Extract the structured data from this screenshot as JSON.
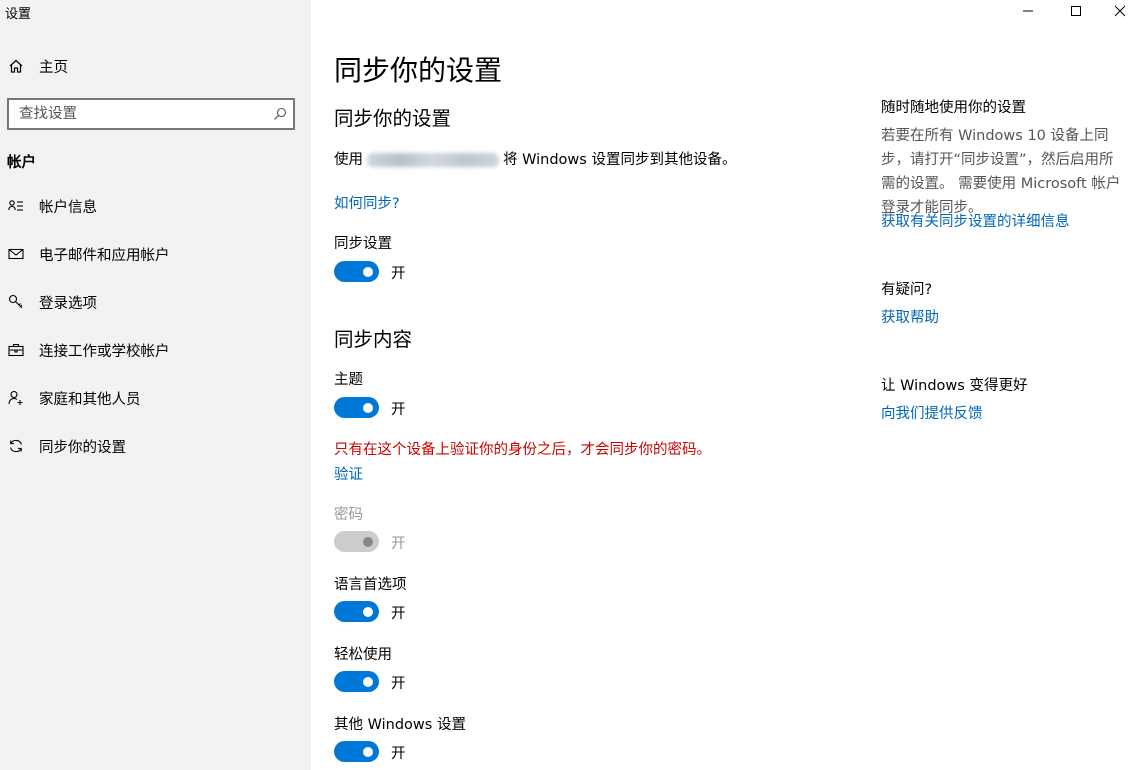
{
  "window": {
    "title": "设置",
    "controls": {
      "minimize_icon": "minimize-icon",
      "maximize_icon": "maximize-icon",
      "close_icon": "close-icon"
    }
  },
  "sidebar": {
    "home_label": "主页",
    "search": {
      "placeholder": "查找设置",
      "value": ""
    },
    "section_title": "帐户",
    "items": [
      {
        "label": "帐户信息",
        "icon": "account-info-icon"
      },
      {
        "label": "电子邮件和应用帐户",
        "icon": "mail-icon"
      },
      {
        "label": "登录选项",
        "icon": "key-icon"
      },
      {
        "label": "连接工作或学校帐户",
        "icon": "briefcase-icon"
      },
      {
        "label": "家庭和其他人员",
        "icon": "add-person-icon"
      },
      {
        "label": "同步你的设置",
        "icon": "sync-icon"
      }
    ]
  },
  "main": {
    "page_title": "同步你的设置",
    "sync_heading": "同步你的设置",
    "sync_desc_prefix": "使用",
    "sync_desc_suffix": "将 Windows 设置同步到其他设备。",
    "how_link": "如何同步?",
    "sync_setting_label": "同步设置",
    "sync_setting_state": "开",
    "content_heading": "同步内容",
    "theme_label": "主题",
    "theme_state": "开",
    "warning": "只有在这个设备上验证你的身份之后，才会同步你的密码。",
    "verify_link": "验证",
    "password_label": "密码",
    "password_state": "开",
    "language_label": "语言首选项",
    "language_state": "开",
    "ease_label": "轻松使用",
    "ease_state": "开",
    "other_label": "其他 Windows 设置",
    "other_state": "开"
  },
  "aside": {
    "anywhere_title": "随时随地使用你的设置",
    "anywhere_text": "若要在所有 Windows 10 设备上同步，请打开“同步设置”，然后启用所需的设置。 需要使用 Microsoft 帐户登录才能同步。",
    "details_link": "获取有关同步设置的详细信息",
    "question_title": "有疑问?",
    "help_link": "获取帮助",
    "feedback_title": "让 Windows 变得更好",
    "feedback_link": "向我们提供反馈"
  },
  "colors": {
    "accent": "#0078d7",
    "link": "#0067b8",
    "warning": "#c50500",
    "sidebar_bg": "#f2f2f2"
  }
}
